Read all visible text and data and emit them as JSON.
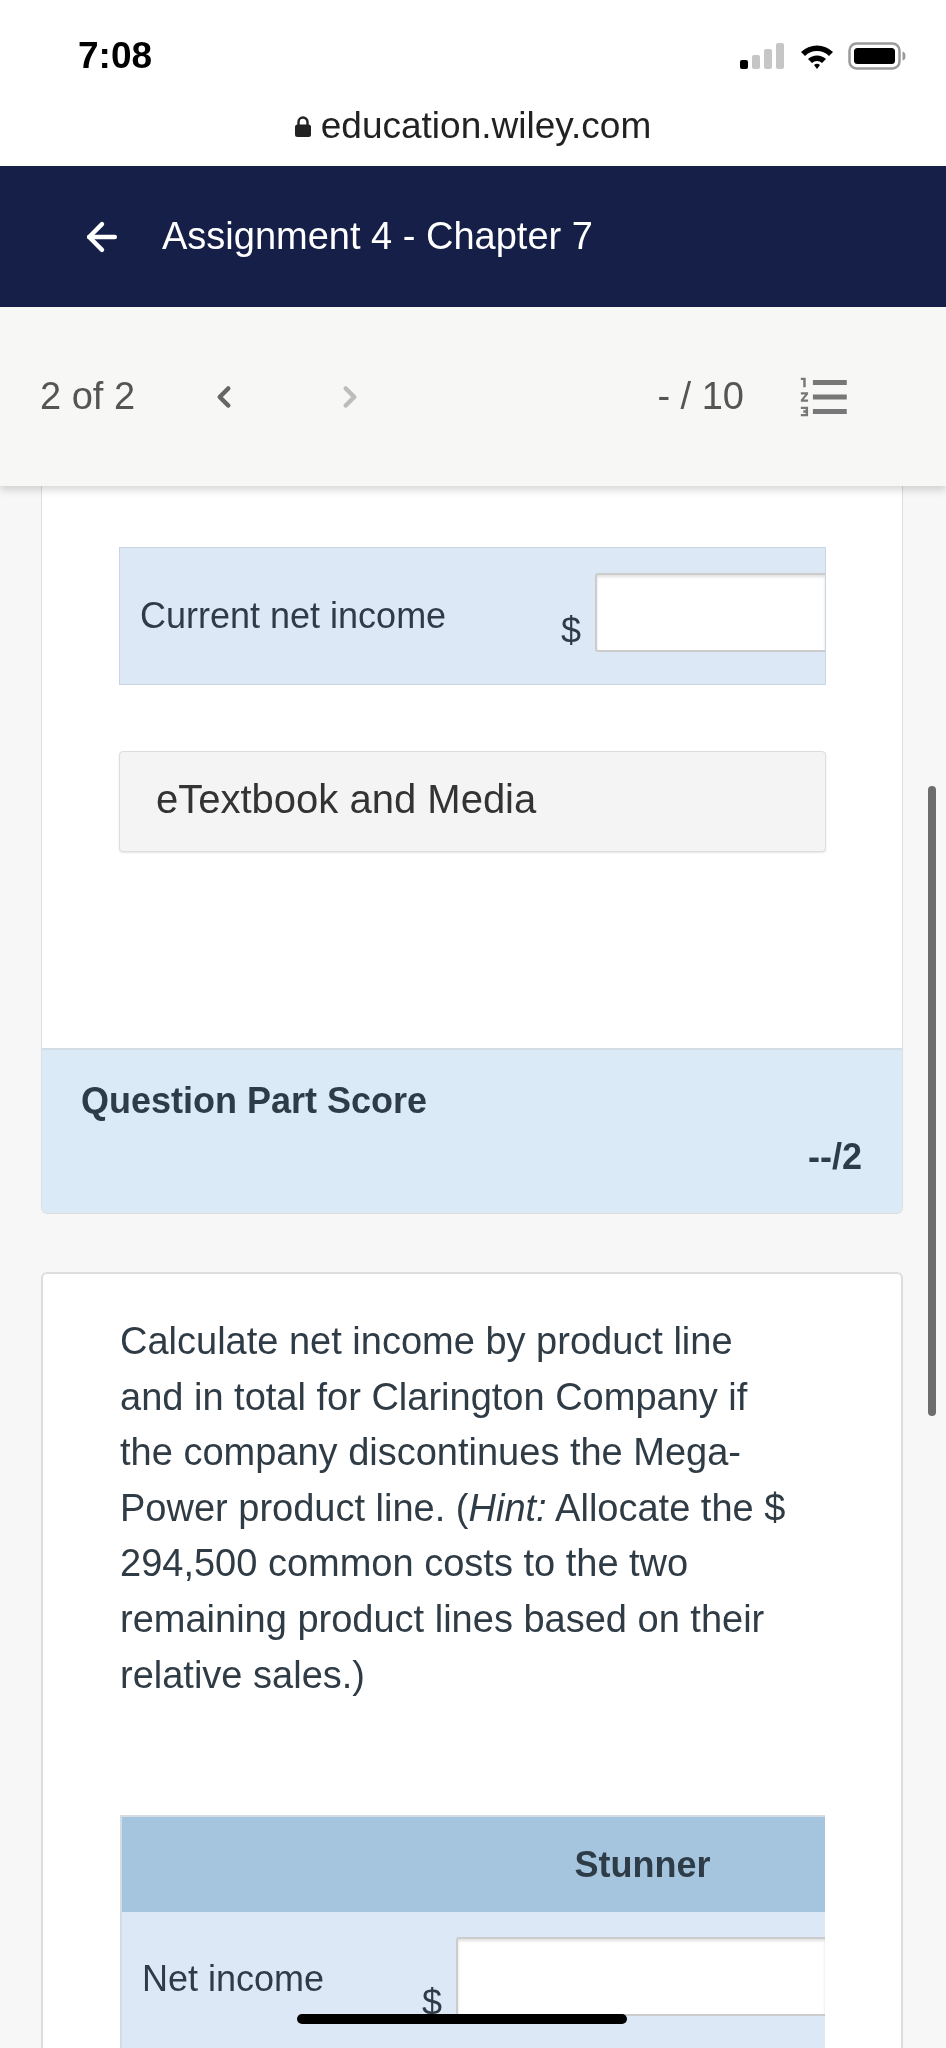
{
  "status_bar": {
    "time": "7:08"
  },
  "browser": {
    "url": "education.wiley.com"
  },
  "header": {
    "title": "Assignment 4 - Chapter 7"
  },
  "toolbar": {
    "position": "2 of 2",
    "previous": {
      "disabled": false
    },
    "next": {
      "disabled": true
    },
    "score": "- / 10"
  },
  "answer_rows": [
    {
      "label": "Current net income",
      "currency": "$"
    }
  ],
  "resources": {
    "label": "eTextbook and Media"
  },
  "part_score": {
    "title": "Question Part Score",
    "score": "--/2"
  },
  "question": {
    "text": "Calculate net income by product line and in total for Clarington Company if the company discontinues the Mega-Power product line. (*Hint:* Allocate the $ 294,500 common costs to the two remaining product lines based on their relative sales.)"
  },
  "table": {
    "columns": [
      "Stunner"
    ],
    "rows": [
      {
        "label": "Net income",
        "currency": "$"
      }
    ]
  }
}
